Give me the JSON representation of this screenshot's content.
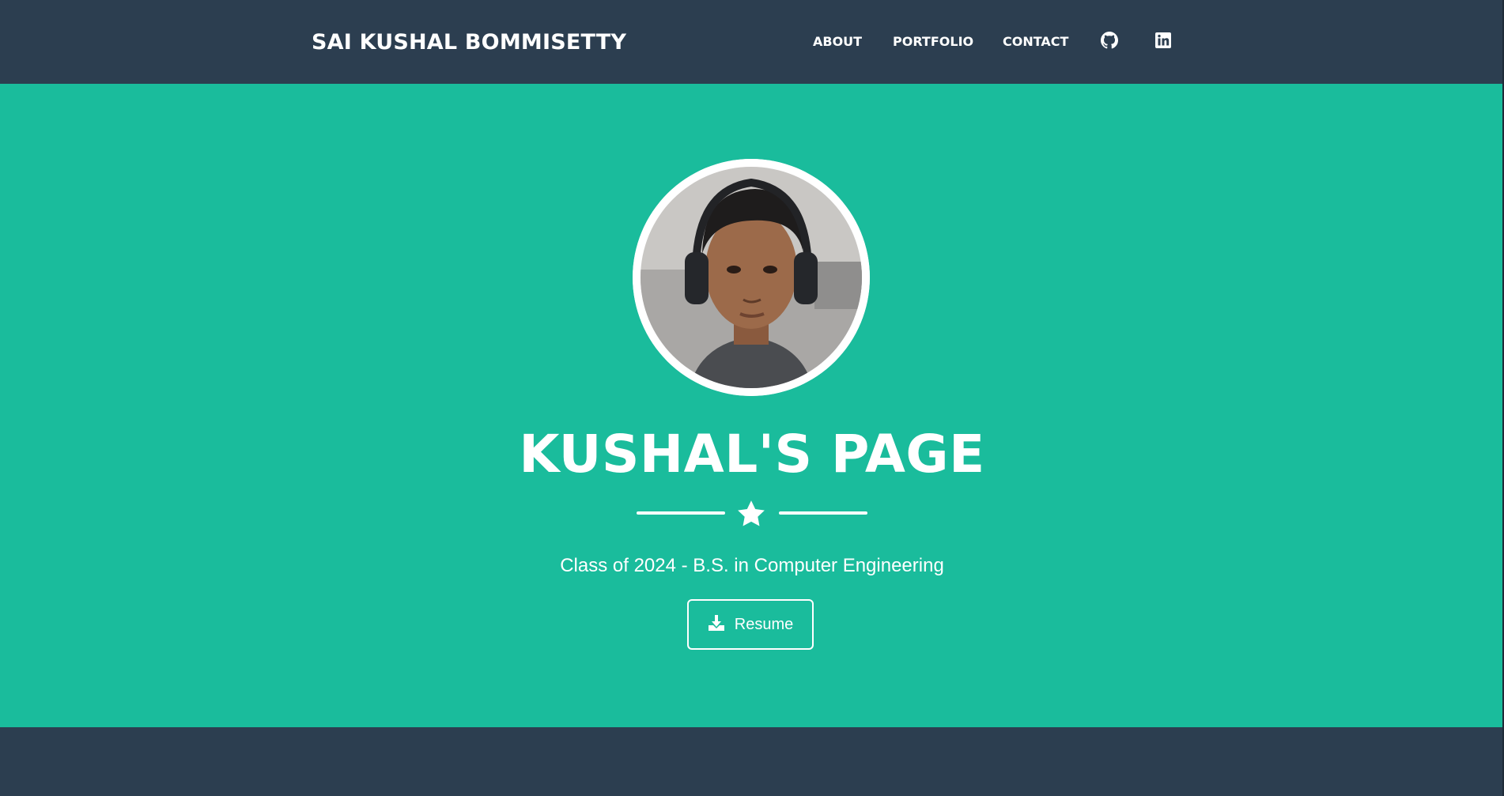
{
  "colors": {
    "navbar_bg": "#2c3e50",
    "accent": "#1abc9c",
    "text": "#ffffff"
  },
  "navbar": {
    "brand": "SAI KUSHAL BOMMISETTY",
    "links": [
      {
        "label": "ABOUT"
      },
      {
        "label": "PORTFOLIO"
      },
      {
        "label": "CONTACT"
      }
    ],
    "icons": [
      "github-icon",
      "linkedin-icon"
    ]
  },
  "masthead": {
    "title": "KUSHAL'S PAGE",
    "subtitle": "Class of 2024 - B.S. in Computer Engineering",
    "divider_icon": "star-icon",
    "resume_button": {
      "label": "Resume",
      "icon": "download-icon"
    }
  }
}
